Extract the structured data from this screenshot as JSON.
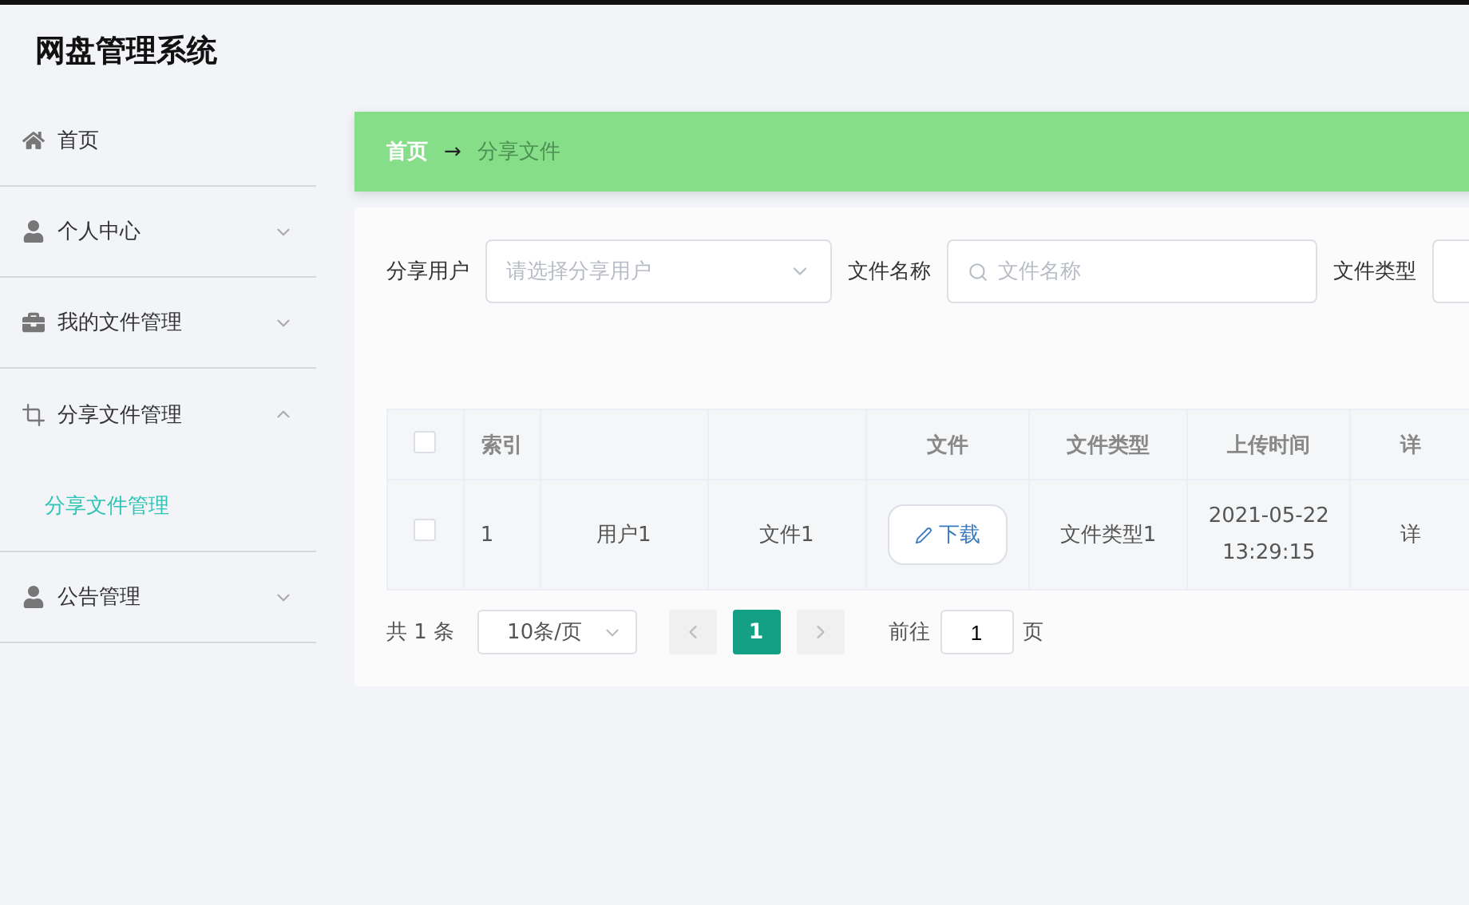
{
  "app_title": "网盘管理系统",
  "sidebar": {
    "items": [
      {
        "label": "首页",
        "kind": "link"
      },
      {
        "label": "个人中心",
        "kind": "group",
        "expanded": false
      },
      {
        "label": "我的文件管理",
        "kind": "group",
        "expanded": false
      },
      {
        "label": "分享文件管理",
        "kind": "group",
        "expanded": true,
        "children": [
          {
            "label": "分享文件管理",
            "selected": true
          }
        ]
      },
      {
        "label": "公告管理",
        "kind": "group",
        "expanded": false
      }
    ]
  },
  "breadcrumb": {
    "items": [
      {
        "label": "首页",
        "selected": false
      },
      {
        "label": "分享文件",
        "selected": true
      }
    ],
    "separator": "→"
  },
  "filters": [
    {
      "kind": "select",
      "label": "分享用户",
      "placeholder": "请选择分享用户"
    },
    {
      "kind": "search",
      "label": "文件名称",
      "placeholder": "文件名称"
    },
    {
      "kind": "select",
      "label": "文件类型"
    }
  ],
  "table": {
    "columns": [
      {
        "kind": "checkbox",
        "checked": false
      },
      {
        "kind": "text",
        "label": "索引"
      },
      {
        "kind": "text"
      },
      {
        "kind": "text"
      },
      {
        "kind": "text",
        "label": "文件"
      },
      {
        "kind": "text",
        "label": "文件类型"
      },
      {
        "kind": "text",
        "label": "上传时间"
      },
      {
        "kind": "text",
        "label": "详"
      }
    ],
    "rows": [
      {
        "cells": [
          {
            "kind": "checkbox",
            "checked": false
          },
          "1",
          "用户1",
          "文件1",
          {
            "kind": "button",
            "label": "下载"
          },
          "文件类型1",
          "2021-05-22\n13:29:15",
          "详"
        ]
      }
    ]
  },
  "pagination": {
    "total": "共 1 条",
    "page_size": "10条/页",
    "pages": [
      {
        "label": "1",
        "selected": true
      }
    ],
    "goto_label": "前往",
    "goto_value": "1",
    "goto_suffix": "页"
  }
}
